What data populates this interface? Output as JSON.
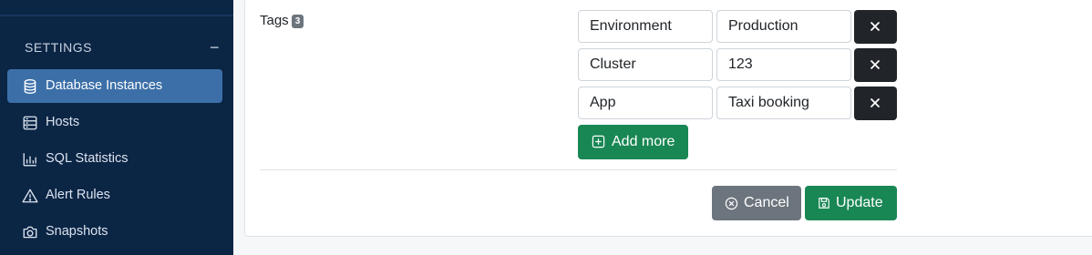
{
  "sidebar": {
    "section_title": "SETTINGS",
    "collapse_symbol": "−",
    "items": [
      {
        "label": "Database Instances",
        "icon": "database-icon",
        "active": true
      },
      {
        "label": "Hosts",
        "icon": "server-icon",
        "active": false
      },
      {
        "label": "SQL Statistics",
        "icon": "bar-chart-icon",
        "active": false
      },
      {
        "label": "Alert Rules",
        "icon": "warning-icon",
        "active": false
      },
      {
        "label": "Snapshots",
        "icon": "camera-icon",
        "active": false
      }
    ]
  },
  "form": {
    "tags_label": "Tags",
    "tags_count": "3",
    "tags": [
      {
        "key": "Environment",
        "value": "Production"
      },
      {
        "key": "Cluster",
        "value": "123"
      },
      {
        "key": "App",
        "value": "Taxi booking"
      }
    ],
    "add_more_label": "Add more",
    "cancel_label": "Cancel",
    "update_label": "Update"
  },
  "colors": {
    "sidebar_bg": "#0b2545",
    "active_item": "#3c6fa8",
    "success": "#198754",
    "secondary": "#6c757d",
    "dark": "#212529"
  }
}
